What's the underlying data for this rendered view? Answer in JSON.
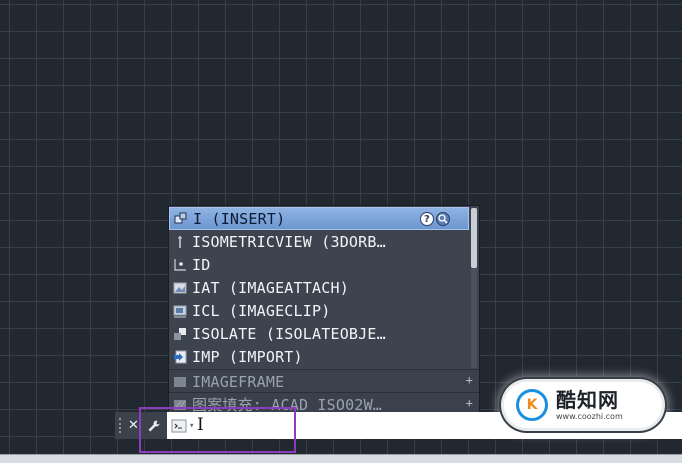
{
  "suggestions": {
    "items": [
      {
        "label": "I (INSERT)",
        "icon": "insert-block-icon",
        "selected": true
      },
      {
        "label": "ISOMETRICVIEW (3DORB…",
        "icon": "isometric-view-icon"
      },
      {
        "label": "ID",
        "icon": "id-point-icon"
      },
      {
        "label": "IAT (IMAGEATTACH)",
        "icon": "image-attach-icon"
      },
      {
        "label": "ICL (IMAGECLIP)",
        "icon": "image-clip-icon"
      },
      {
        "label": "ISOLATE (ISOLATEOBJE…",
        "icon": "isolate-objects-icon"
      },
      {
        "label": "IMP (IMPORT)",
        "icon": "import-icon"
      }
    ],
    "system_variables": [
      {
        "label": "IMAGEFRAME",
        "icon": "system-variable-icon",
        "expand": "+"
      },
      {
        "label": "图案填充: ACAD_ISO02W…",
        "icon": "hatch-pattern-icon",
        "expand": "+"
      }
    ],
    "help_icon": "?",
    "internet_search_icon": "globe-search-icon"
  },
  "command_line": {
    "close_icon": "✕",
    "customize_icon": "wrench-icon",
    "prompt_icon": "command-prompt-icon",
    "prompt_arrow": "▾",
    "value": "I"
  },
  "watermark": {
    "logo": "K",
    "title": "酷知网",
    "url": "www.coozhi.com"
  },
  "colors": {
    "canvas": "#212830",
    "popup": "#3d4450",
    "selection": "#7aa0d8",
    "highlight_box": "#8e3bbf"
  }
}
